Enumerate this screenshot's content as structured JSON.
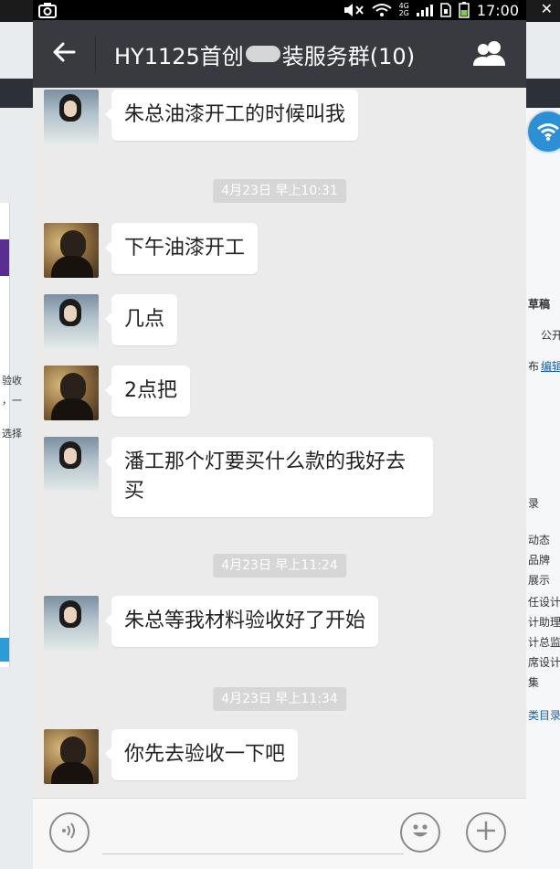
{
  "status_bar": {
    "time": "17:00",
    "network": [
      "4G",
      "2G"
    ]
  },
  "header": {
    "back_label": "←",
    "title_before": "HY1125首创",
    "title_after": "装服务群(10)"
  },
  "messages": [
    {
      "sender": "woman",
      "text": "朱总油漆开工的时候叫我"
    },
    {
      "timestamp": "4月23日 早上10:31"
    },
    {
      "sender": "man",
      "text": "下午油漆开工"
    },
    {
      "sender": "woman",
      "text": "几点"
    },
    {
      "sender": "man",
      "text": "2点把"
    },
    {
      "sender": "woman",
      "text": "潘工那个灯要买什么款的我好去买"
    },
    {
      "timestamp": "4月23日 早上11:24"
    },
    {
      "sender": "woman",
      "text": "朱总等我材料验收好了开始"
    },
    {
      "timestamp": "4月23日 早上11:34"
    },
    {
      "sender": "man",
      "text": "你先去验收一下吧"
    }
  ],
  "input_bar": {
    "placeholder": ""
  },
  "background_fragments": {
    "right": [
      "草稿",
      "公开",
      "布",
      "编辑",
      "录",
      "动态",
      "品牌",
      "展示",
      "任设计",
      "计助理",
      "计总监",
      "席设计",
      "集",
      "类目录"
    ],
    "left": [
      "验收",
      "，一",
      "选择"
    ]
  },
  "colors": {
    "title_bar": "#393a3f",
    "chat_bg": "#ebebeb",
    "bubble": "#ffffff",
    "timestamp_bg": "#d6d6d6"
  },
  "icons": [
    "camera-icon",
    "mute-icon",
    "wifi-icon",
    "signal-icon",
    "battery-icon",
    "back-arrow-icon",
    "group-members-icon",
    "voice-icon",
    "emoji-icon",
    "plus-icon"
  ]
}
